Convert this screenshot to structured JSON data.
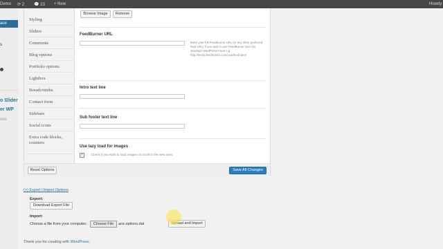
{
  "adminbar": {
    "site": "Demo",
    "updates": "2",
    "comments": "23",
    "new_label": "+ New",
    "howdy": "Howdy"
  },
  "leftmenu": {
    "active_item": "ace",
    "items": [
      "s",
      "o Slider",
      "er WP",
      "ons"
    ],
    "badge": "1"
  },
  "tabs": [
    "Styling",
    "Sliders",
    "Comments",
    "Blog options",
    "Portfolio options",
    "Lightbox",
    "Breadcrumbs",
    "Contact form",
    "Sidebars",
    "Social icons",
    "Extra code blocks, counters"
  ],
  "content": {
    "browse_label": "Browse Image",
    "remove_label": "Remove",
    "feedburner": {
      "title": "FeedBurner URL",
      "value": "",
      "help": "Enter your full FeedBurner URL (or any other preferred feed URL) if you wish to use FeedBurner over the standard WordPress Feed e.g. http://feeds.feedburner.com/yourfeedname"
    },
    "intro": {
      "title": "Intro text line",
      "value": ""
    },
    "subfooter": {
      "title": "Sub footer text line",
      "value": ""
    },
    "lazyload": {
      "title": "Use lazy load for images",
      "checked": true,
      "help": "Check if you want to load images on scroll to the view area"
    }
  },
  "footer": {
    "reset_label": "Reset Options",
    "save_label": "Save All Changes"
  },
  "export_import": {
    "toggle_label": "(+) Export / Import Options",
    "export_title": "Export:",
    "download_label": "Download Export File",
    "import_title": "Import:",
    "choose_prompt": "Choose a file from your computer:",
    "choose_label": "Choose File",
    "file_name": "ace.options.dat",
    "upload_label": "Upload and Import"
  },
  "wp_footer": {
    "prefix": "Thank you for creating with ",
    "link": "WordPress",
    "suffix": "."
  }
}
